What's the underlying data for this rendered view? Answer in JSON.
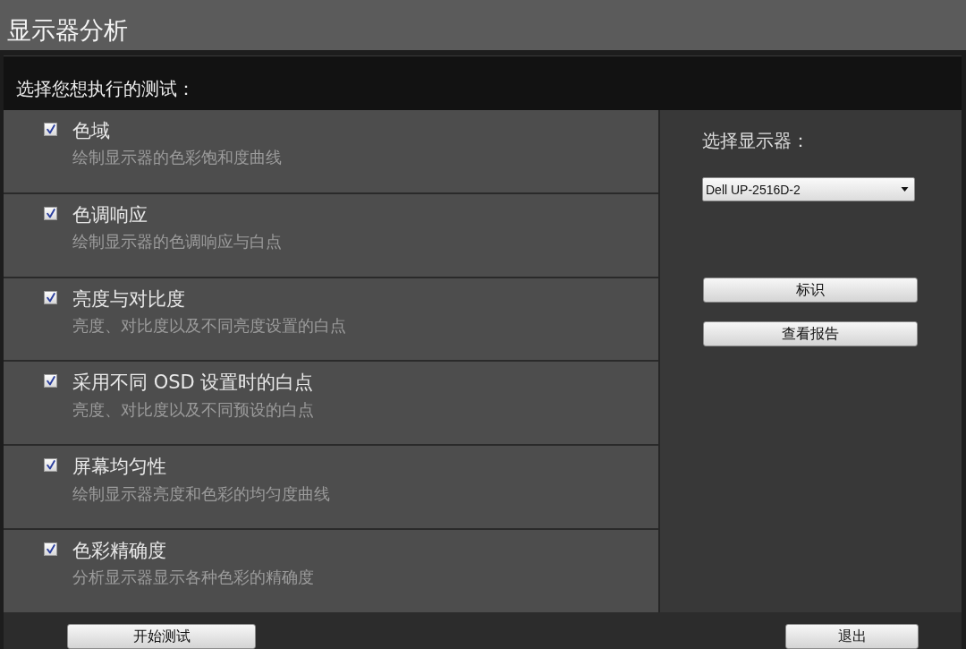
{
  "window": {
    "title": "显示器分析"
  },
  "tests": {
    "heading": "选择您想执行的测试：",
    "items": [
      {
        "label": "色域",
        "description": "绘制显示器的色彩饱和度曲线",
        "checked": true
      },
      {
        "label": "色调响应",
        "description": "绘制显示器的色调响应与白点",
        "checked": true
      },
      {
        "label": "亮度与对比度",
        "description": "亮度、对比度以及不同亮度设置的白点",
        "checked": true
      },
      {
        "label": "采用不同 OSD 设置时的白点",
        "description": "亮度、对比度以及不同预设的白点",
        "checked": true
      },
      {
        "label": "屏幕均匀性",
        "description": "绘制显示器亮度和色彩的均匀度曲线",
        "checked": true
      },
      {
        "label": "色彩精确度",
        "description": "分析显示器显示各种色彩的精确度",
        "checked": true
      }
    ]
  },
  "display_panel": {
    "label": "选择显示器：",
    "display_select": {
      "value": "Dell UP-2516D-2"
    },
    "buttons": [
      "标识",
      "查看报告"
    ]
  },
  "footer": {
    "buttons": [
      "开始测试",
      "退出"
    ]
  }
}
